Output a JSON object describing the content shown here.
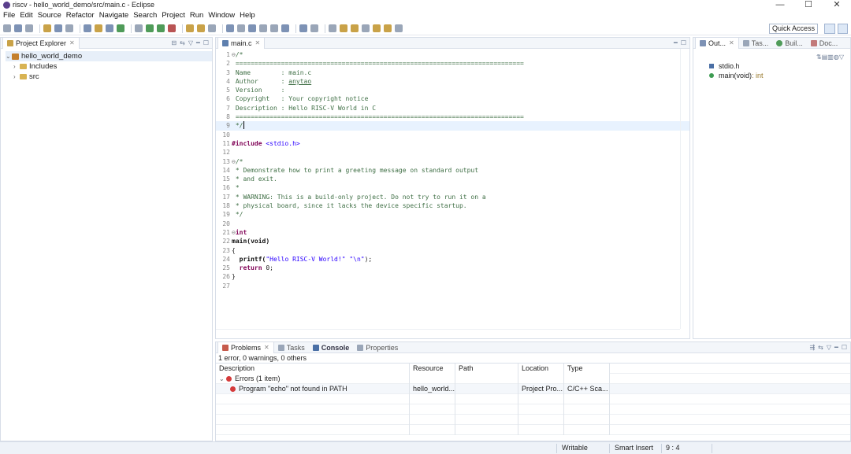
{
  "window": {
    "title": "riscv - hello_world_demo/src/main.c - Eclipse",
    "controls": [
      "—",
      "☐",
      "✕"
    ]
  },
  "menu": [
    "File",
    "Edit",
    "Source",
    "Refactor",
    "Navigate",
    "Search",
    "Project",
    "Run",
    "Window",
    "Help"
  ],
  "toolbar": {
    "quick_access": "Quick Access"
  },
  "project_explorer": {
    "tab": "Project Explorer",
    "items": [
      {
        "label": "hello_world_demo",
        "level": 0,
        "expanded": true
      },
      {
        "label": "Includes",
        "level": 1,
        "expanded": false
      },
      {
        "label": "src",
        "level": 1,
        "expanded": false
      }
    ]
  },
  "editor": {
    "tab": "main.c",
    "lines": [
      "1",
      "2",
      "3",
      "4",
      "5",
      "6",
      "7",
      "8",
      "9",
      "10",
      "11",
      "12",
      "13",
      "14",
      "15",
      "16",
      "17",
      "18",
      "19",
      "20",
      "21",
      "22",
      "23",
      "24",
      "25",
      "26",
      "27"
    ],
    "code": {
      "l1": "/*",
      "l2": " ============================================================================",
      "l3": " Name        : main.c",
      "l4a": " Author      : ",
      "l4b": "anytao",
      "l5": " Version     :",
      "l6": " Copyright   : Your copyright notice",
      "l7": " Description : Hello RISC-V World in C",
      "l8": " ============================================================================",
      "l9": " */",
      "l11a": "#include",
      "l11b": " <stdio.h>",
      "l13": "/*",
      "l14": " * Demonstrate how to print a greeting message on standard output",
      "l15": " * and exit.",
      "l16": " *",
      "l17": " * WARNING: This is a build-only project. Do not try to run it on a",
      "l18": " * physical board, since it lacks the device specific startup.",
      "l19": " */",
      "l21": "int",
      "l22": "main(void)",
      "l23": "{",
      "l24a": "  printf(",
      "l24b": "\"Hello RISC-V World!\" \"\\n\"",
      "l24c": ");",
      "l25a": "  return",
      "l25b": " 0;",
      "l26": "}"
    }
  },
  "outline": {
    "tabs": [
      "Out...",
      "Tas...",
      "Buil...",
      "Doc..."
    ],
    "items": [
      {
        "label": "stdio.h"
      },
      {
        "label": "main(void)",
        "ret": " : int"
      }
    ]
  },
  "problems": {
    "tabs": [
      "Problems",
      "Tasks",
      "Console",
      "Properties"
    ],
    "summary": "1 error, 0 warnings, 0 others",
    "columns": [
      "Description",
      "Resource",
      "Path",
      "Location",
      "Type"
    ],
    "group": "Errors (1 item)",
    "error": {
      "description": "Program \"echo\" not found in PATH",
      "resource": "hello_world...",
      "path": "",
      "location": "Project Pro...",
      "type": "C/C++ Sca..."
    }
  },
  "status": {
    "writable": "Writable",
    "insert": "Smart Insert",
    "pos": "9 : 4"
  }
}
